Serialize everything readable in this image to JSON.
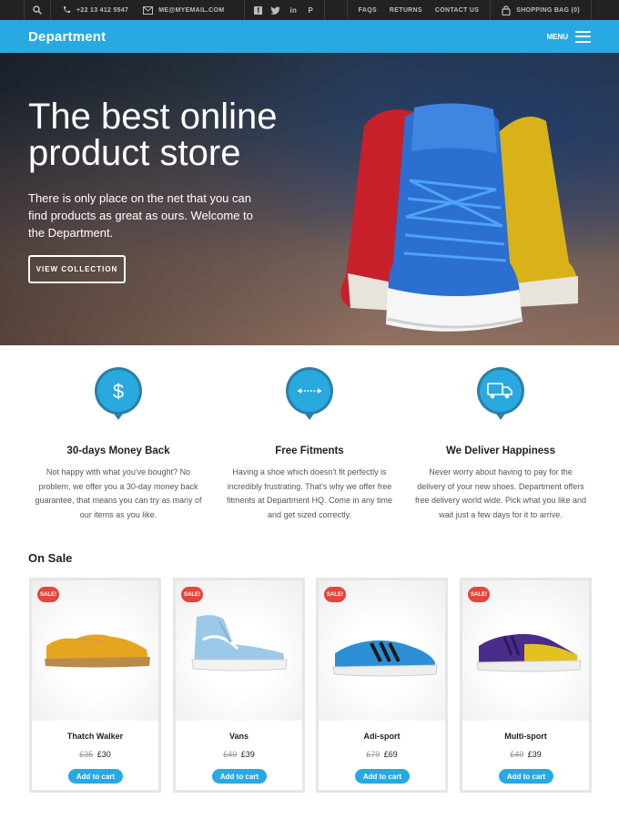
{
  "topbar": {
    "phone": "+22 13 412 5547",
    "email": "ME@MYEMAIL.COM",
    "social_icons": [
      "facebook-icon",
      "twitter-icon",
      "linkedin-icon",
      "pinterest-icon"
    ],
    "links": [
      "FAQS",
      "RETURNS",
      "CONTACT US"
    ],
    "bag_label": "SHOPPING BAG (0)"
  },
  "header": {
    "logo": "Department",
    "menu_label": "MENU"
  },
  "hero": {
    "title": "The best online product store",
    "text": "There is only place on the net that you can find products as great as ours. Welcome to the Department.",
    "button_label": "VIEW COLLECTION"
  },
  "features": [
    {
      "icon": "dollar-icon",
      "title": "30-days Money Back",
      "text": "Not happy with what you've bought? No problem, we offer you a 30-day money back guarantee, that means you can try as many of our items as you like."
    },
    {
      "icon": "arrows-horizontal-icon",
      "title": "Free Fitments",
      "text": "Having a shoe which doesn't fit perfectly is incredibly frustrating. That's why we offer free fitments at Department HQ. Come in any time and get sized correctly."
    },
    {
      "icon": "truck-icon",
      "title": "We Deliver Happiness",
      "text": "Never worry about having to pay for the delivery of your new shoes. Department offers free delivery world wide. Pick what you like and wait just a few days for it to arrive."
    }
  ],
  "on_sale": {
    "heading": "On Sale",
    "badge_label": "SALE!",
    "cart_label": "Add to cart",
    "products": [
      {
        "name": "Thatch Walker",
        "old_price": "£35",
        "price": "£30"
      },
      {
        "name": "Vans",
        "old_price": "£49",
        "price": "£39"
      },
      {
        "name": "Adi-sport",
        "old_price": "£79",
        "price": "£69"
      },
      {
        "name": "Multi-sport",
        "old_price": "£49",
        "price": "£39"
      }
    ]
  },
  "colors": {
    "accent": "#29a9e1",
    "topbar": "#222222",
    "sale_badge": "#e2463c"
  }
}
